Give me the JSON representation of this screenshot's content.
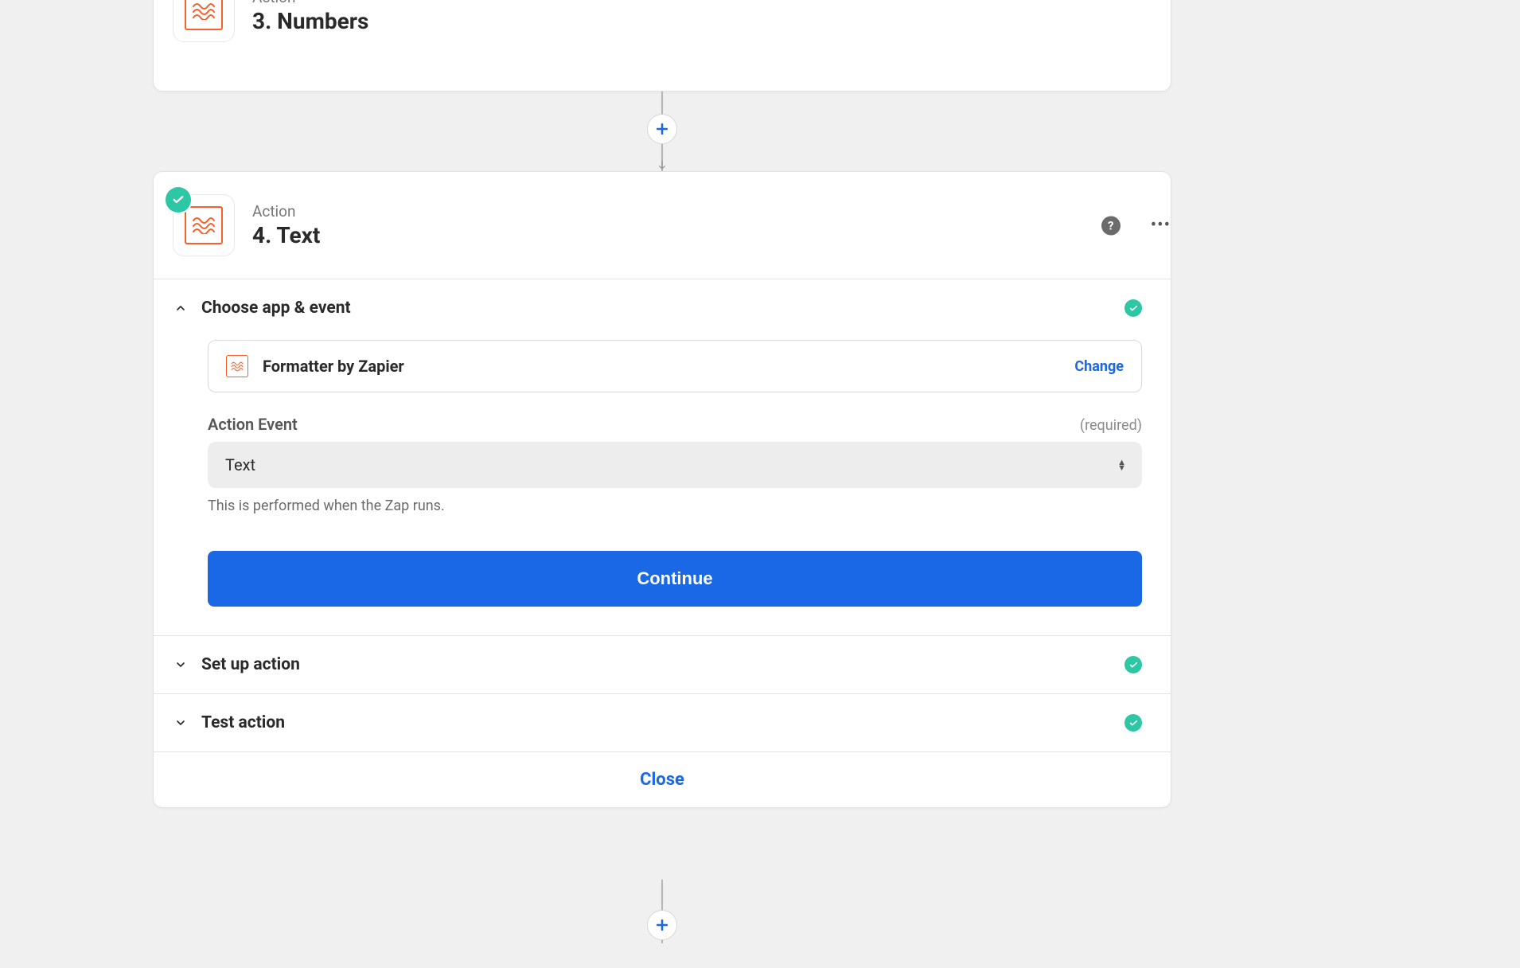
{
  "step3": {
    "label": "Action",
    "title": "3. Numbers"
  },
  "step4": {
    "label": "Action",
    "title": "4. Text",
    "sections": {
      "choose": {
        "title": "Choose app & event",
        "app_name": "Formatter by Zapier",
        "change_label": "Change",
        "field_label": "Action Event",
        "required_label": "(required)",
        "select_value": "Text",
        "helper_text": "This is performed when the Zap runs.",
        "continue_label": "Continue"
      },
      "setup": {
        "title": "Set up action"
      },
      "test": {
        "title": "Test action"
      }
    },
    "close_label": "Close"
  }
}
